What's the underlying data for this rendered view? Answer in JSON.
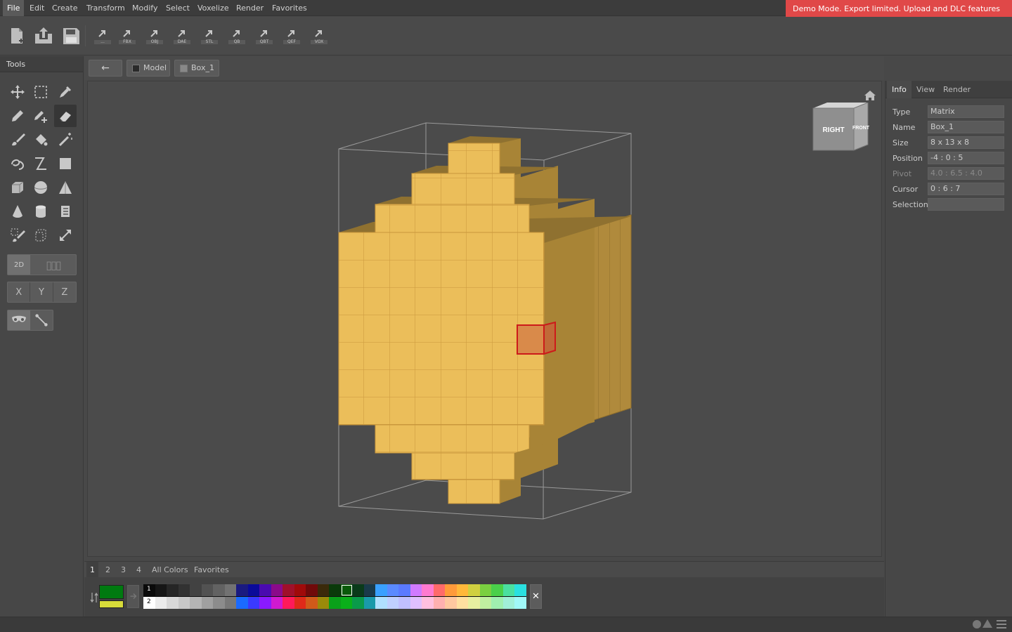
{
  "menu": [
    "File",
    "Edit",
    "Create",
    "Transform",
    "Modify",
    "Select",
    "Voxelize",
    "Render",
    "Favorites"
  ],
  "demo_banner": "Demo Mode. Export limited. Upload and DLC features disabled.",
  "toolbar": {
    "file_buttons": [
      "new-file-icon",
      "open-file-icon",
      "save-file-icon"
    ],
    "export_buttons": [
      "...",
      "FBX",
      "OBJ",
      "DAE",
      "STL",
      "QB",
      "QBT",
      "QEF",
      "VOX"
    ]
  },
  "tools": {
    "header": "Tools",
    "mode_2d": "2D",
    "mode_3d": "▯▯▯",
    "axes": [
      "X",
      "Y",
      "Z"
    ]
  },
  "breadcrumb": {
    "back": "←",
    "model": "Model",
    "matrix": "Box_1"
  },
  "view_cube": {
    "right": "RIGHT",
    "front": "FRONT"
  },
  "info_panel": {
    "tabs": [
      "Info",
      "View",
      "Render"
    ],
    "rows": [
      {
        "label": "Type",
        "value": "Matrix",
        "dim": false
      },
      {
        "label": "Name",
        "value": "Box_1",
        "dim": false
      },
      {
        "label": "Size",
        "value": "8 x 13 x 8",
        "dim": false
      },
      {
        "label": "Position",
        "value": "-4 : 0 : 5",
        "dim": false
      },
      {
        "label": "Pivot",
        "value": "4.0 : 6.5 : 4.0",
        "dim": true
      },
      {
        "label": "Cursor",
        "value": "0 : 6 : 7",
        "dim": false
      },
      {
        "label": "Selection",
        "value": "",
        "dim": false
      }
    ]
  },
  "palette": {
    "tabs": [
      "1",
      "2",
      "3",
      "4",
      "All Colors",
      "Favorites"
    ],
    "row_labels": [
      "1",
      "2"
    ],
    "primary_color": "#007a10",
    "secondary_color": "#d8dc3a",
    "row1": [
      "#0a0a0a",
      "#161616",
      "#262626",
      "#323232",
      "#424242",
      "#525252",
      "#626262",
      "#727272",
      "#1a1a80",
      "#0a0a9a",
      "#4a0ab0",
      "#8a0a8a",
      "#a0102a",
      "#a00a0a",
      "#700a0a",
      "#3a2a0a",
      "#0a3a0a",
      "#0a5a0a",
      "#0a3a1a",
      "#1a3a4a",
      "#3aa0ff",
      "#5a8aff",
      "#5a7aff",
      "#d07aff",
      "#ff7ad0",
      "#ff6a6a",
      "#ff9a3a",
      "#ffb83a",
      "#d0d040",
      "#7ad040",
      "#4ad04a",
      "#4ae0a0",
      "#2ae0e0"
    ],
    "row2": [
      "#ffffff",
      "#ebebeb",
      "#d8d8d8",
      "#c8c8c8",
      "#b4b4b4",
      "#a0a0a0",
      "#8c8c8c",
      "#787878",
      "#1a6aff",
      "#3a3aff",
      "#8a1aff",
      "#d01ad0",
      "#ff1a5a",
      "#e02a1a",
      "#d05a1a",
      "#9a8a0a",
      "#0aa01a",
      "#0ab01a",
      "#0a9a4a",
      "#1a9aaa",
      "#b0e0ff",
      "#c0d0ff",
      "#c0c0ff",
      "#e0c0ff",
      "#ffc0e0",
      "#ffb0b0",
      "#ffc8a0",
      "#ffe0a0",
      "#e8f0a0",
      "#c0f0a0",
      "#a0f0b0",
      "#a0f0d8",
      "#a0f8f8"
    ]
  }
}
